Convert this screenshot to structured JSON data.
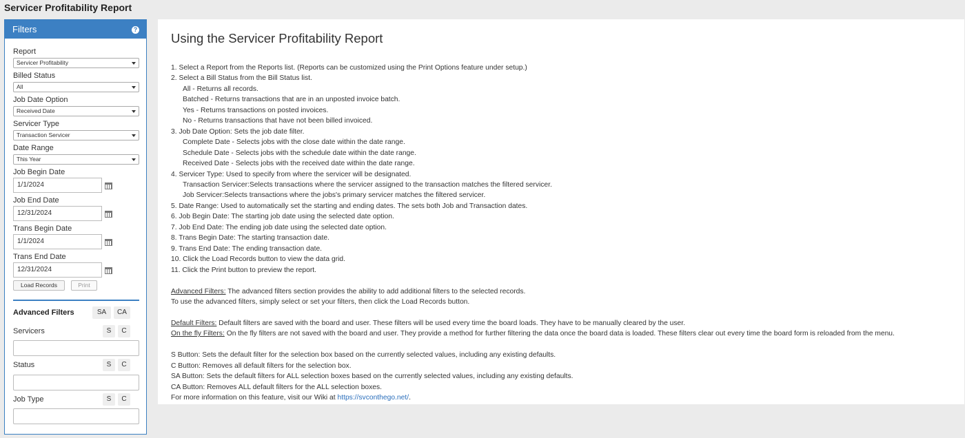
{
  "page_title": "Servicer Profitability Report",
  "filters": {
    "header": "Filters",
    "help_icon": "question-icon",
    "report_label": "Report",
    "report_value": "Servicer Profitability",
    "billed_label": "Billed Status",
    "billed_value": "All",
    "jobdate_label": "Job Date Option",
    "jobdate_value": "Received Date",
    "servicer_type_label": "Servicer Type",
    "servicer_type_value": "Transaction Servicer",
    "date_range_label": "Date Range",
    "date_range_value": "This Year",
    "job_begin_label": "Job Begin Date",
    "job_begin_value": "1/1/2024",
    "job_end_label": "Job End Date",
    "job_end_value": "12/31/2024",
    "trans_begin_label": "Trans Begin Date",
    "trans_begin_value": "1/1/2024",
    "trans_end_label": "Trans End Date",
    "trans_end_value": "12/31/2024",
    "load_label": "Load Records",
    "print_label": "Print",
    "advanced_title": "Advanced Filters",
    "sa_label": "SA",
    "ca_label": "CA",
    "s_label": "S",
    "c_label": "C",
    "servicers_label": "Servicers",
    "status_label": "Status",
    "jobtype_label": "Job Type"
  },
  "main": {
    "title": "Using the Servicer Profitability Report",
    "lines": {
      "l1": "1.   Select a Report from the Reports list. (Reports can be customized using the Print Options feature under setup.)",
      "l2": "2.   Select a Bill Status from the Bill Status list.",
      "l2a": "All - Returns all records.",
      "l2b": "Batched - Returns transactions that are in an unposted invoice batch.",
      "l2c": "Yes - Returns transactions on posted invoices.",
      "l2d": "No - Returns transactions that have not been billed invoiced.",
      "l3": "3.   Job Date Option:  Sets the job date filter.",
      "l3a": "Complete Date - Selects jobs with the close date within the date range.",
      "l3b": "Schedule Date - Selects jobs with the schedule date within the date range.",
      "l3c": "Received Date - Selects jobs with the received date within the date range.",
      "l4": "4.  Servicer Type: Used to specify from where the servicer will be designated.",
      "l4a": "Transaction Servicer:Selects transactions where the servicer assigned to the transaction matches the filtered servicer.",
      "l4b": "Job Servicer:Selects transactions where the jobs's primary servicer matches the filtered servicer.",
      "l5": "5.   Date Range: Used to automatically set the starting and ending dates. The sets both Job and Transaction dates.",
      "l6": "6.   Job Begin Date:  The starting job date using the selected date option.",
      "l7": "7.   Job End Date:  The ending job date using the selected date option.",
      "l8": "8.   Trans Begin Date:  The starting transaction date.",
      "l9": "9.   Trans End Date:  The ending transaction date.",
      "l10": "10. Click the Load Records button to view the data grid.",
      "l11": "11. Click the Print button to preview the report.",
      "adv_head": "Advanced Filters:",
      "adv_text": "  The advanced filters section provides the ability to add additional filters to the selected records.",
      "adv_text2": "To use the advanced filters, simply select or set your filters, then click the Load Records button.",
      "def_head": "Default Filters:",
      "def_text": "  Default filters are saved with the board and user. These filters will be used every time the board loads. They have to be manually cleared by the user.",
      "fly_head": "On the fly Filters:",
      "fly_text": "  On the fly filters are not saved with the board and user. They provide a method for further filtering the data once the board data is loaded. These filters clear out every time the board form is reloaded from the menu.",
      "s_btn": "S Button: Sets the default filter for the selection box based on the currently selected values, including any existing defaults.",
      "c_btn": "C Button: Removes all default filters for the selection box.",
      "sa_btn": "SA Button: Sets the default filters for ALL selection boxes based on the currently selected values, including any existing defaults.",
      "ca_btn": "CA Button: Removes ALL default filters for the ALL selection boxes.",
      "more": "For more information on this feature, visit our Wiki at ",
      "wiki_link": "https://svconthego.net/",
      "period": "."
    }
  }
}
